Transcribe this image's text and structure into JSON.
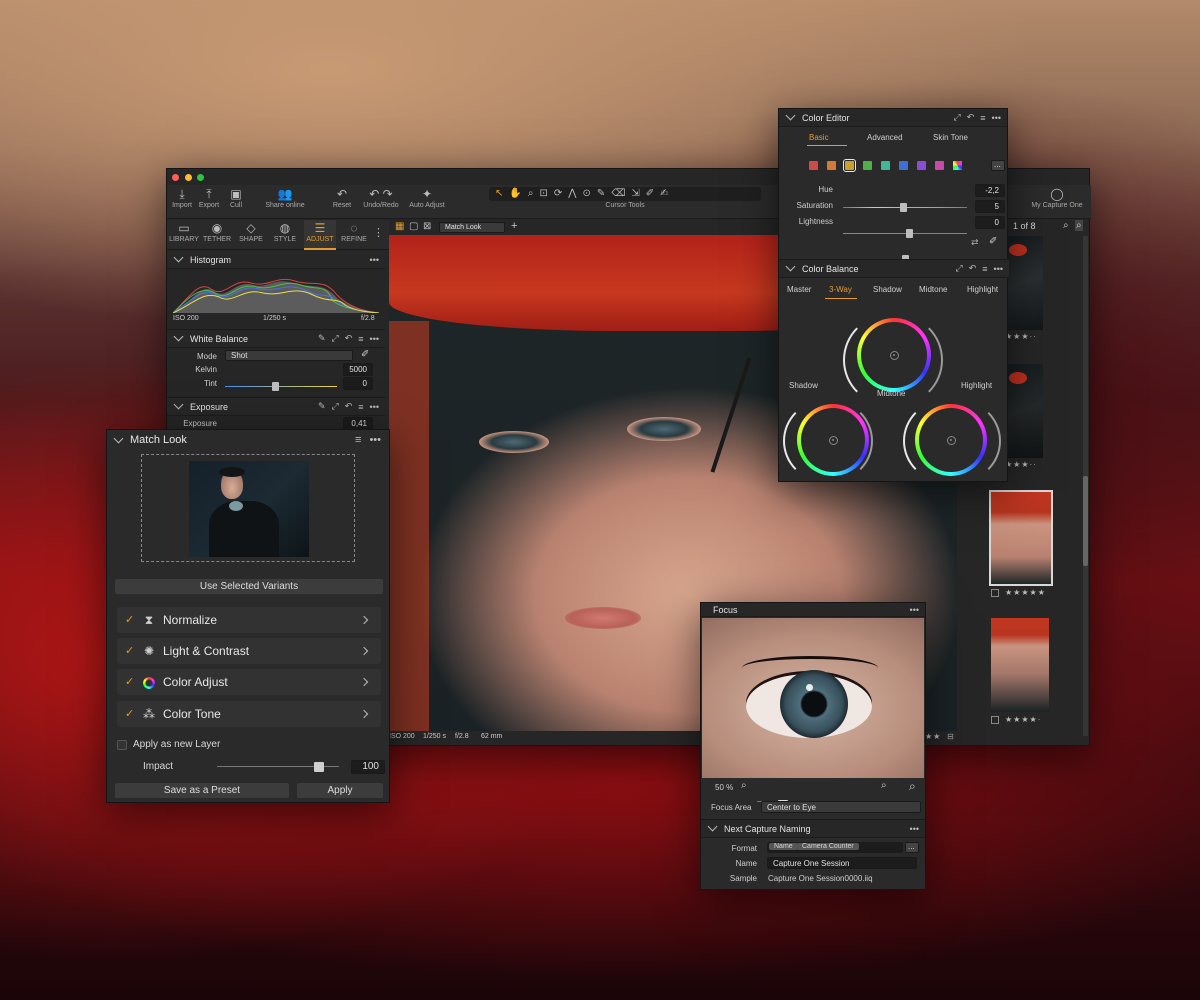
{
  "toolbar": {
    "items": [
      "Import",
      "Export",
      "Cull",
      "Share online",
      "Reset",
      "Undo/Redo",
      "Auto Adjust",
      "Cursor Tools",
      "My Capture One"
    ]
  },
  "tool_tabs": [
    "LIBRARY",
    "TETHER",
    "SHAPE",
    "STYLE",
    "ADJUST",
    "REFINE"
  ],
  "histogram": {
    "title": "Histogram",
    "iso": "ISO 200",
    "shutter": "1/250 s",
    "aperture": "f/2.8"
  },
  "white_balance": {
    "title": "White Balance",
    "mode_label": "Mode",
    "mode_value": "Shot",
    "kelvin_label": "Kelvin",
    "kelvin_value": "5000",
    "kelvin_level": 0.45,
    "tint_label": "Tint",
    "tint_value": "0",
    "tint_level": 0.5
  },
  "exposure": {
    "title": "Exposure",
    "label": "Exposure",
    "value": "0,41",
    "level": 0.55
  },
  "viewer": {
    "match_look_select": "Match Look",
    "iso": "ISO 200",
    "shutter": "1/250 s",
    "aperture": "f/2.8",
    "focal": "62 mm"
  },
  "match_look": {
    "title": "Match Look",
    "use_selected": "Use Selected Variants",
    "rows": [
      {
        "label": "Normalize"
      },
      {
        "label": "Light & Contrast"
      },
      {
        "label": "Color Adjust"
      },
      {
        "label": "Color Tone"
      }
    ],
    "apply_layer": "Apply as new Layer",
    "impact_label": "Impact",
    "impact_value": "100",
    "impact_level": 0.82,
    "save_preset": "Save as a Preset",
    "apply": "Apply"
  },
  "color_editor": {
    "title": "Color Editor",
    "tabs": [
      "Basic",
      "Advanced",
      "Skin Tone"
    ],
    "more_btn": "...",
    "swatches": [
      "#d04a4a",
      "#d47a38",
      "#c9a030",
      "#52b04a",
      "#3fb89a",
      "#3d6fd6",
      "#8a4ed4",
      "#c84aa8"
    ],
    "hue_label": "Hue",
    "hue_value": "-2,2",
    "hue_level": 0.48,
    "sat_label": "Saturation",
    "sat_value": "5",
    "sat_level": 0.53,
    "light_label": "Lightness",
    "light_value": "0",
    "light_level": 0.5
  },
  "color_balance": {
    "title": "Color Balance",
    "tabs": [
      "Master",
      "3-Way",
      "Shadow",
      "Midtone",
      "Highlight"
    ],
    "shadow": "Shadow",
    "midtone": "Midtone",
    "highlight": "Highlight"
  },
  "browser": {
    "count": "1 of 8",
    "my_capture": "My Capture One"
  },
  "focus": {
    "title": "Focus",
    "zoom": "50 %",
    "area_label": "Focus Area",
    "area_value": "Center to Eye"
  },
  "naming": {
    "title": "Next Capture Naming",
    "format_label": "Format",
    "token1": "Name",
    "token2": "Camera Counter",
    "more_btn": "...",
    "name_label": "Name",
    "name_value": "Capture One Session",
    "sample_label": "Sample",
    "sample_value": "Capture One Session0000.iiq"
  },
  "colors": {
    "accent": "#e59a2b",
    "panel": "#2a2a2a",
    "dark": "#1c1c1c"
  }
}
